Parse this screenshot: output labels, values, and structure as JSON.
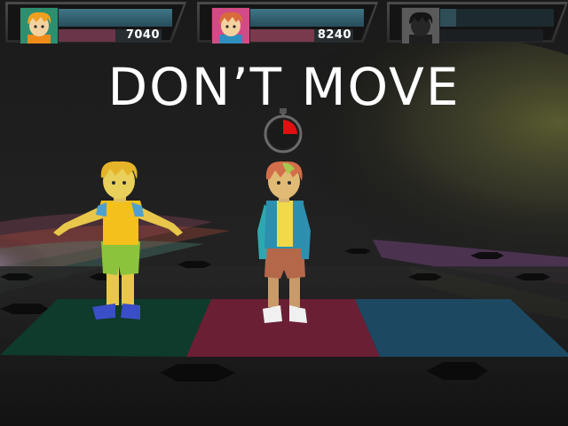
{
  "prompt": {
    "text": "DON’T MOVE"
  },
  "players": [
    {
      "score": "7040",
      "avatar": "player-1-avatar-orange-hair",
      "active": true,
      "score_bar_level": 0.55
    },
    {
      "score": "8240",
      "avatar": "player-2-avatar-pink-hair",
      "active": true,
      "score_bar_level": 0.62
    },
    {
      "score": "",
      "avatar": "player-3-avatar-silhouette",
      "active": false,
      "score_bar_level": 0.0
    }
  ],
  "timer": {
    "icon": "stopwatch-icon",
    "remaining_fraction": 0.25,
    "accent_color": "#e01010"
  },
  "floor_pads": [
    {
      "name": "green-pad",
      "color": "#0e3b2c"
    },
    {
      "name": "red-pad",
      "color": "#6a1f35"
    },
    {
      "name": "blue-pad",
      "color": "#1c4961"
    }
  ],
  "colors": {
    "bar_fill": "#3a6f80",
    "score_bar_fill_1": "#6b3549",
    "score_bar_fill_2": "#7a3a4e"
  }
}
